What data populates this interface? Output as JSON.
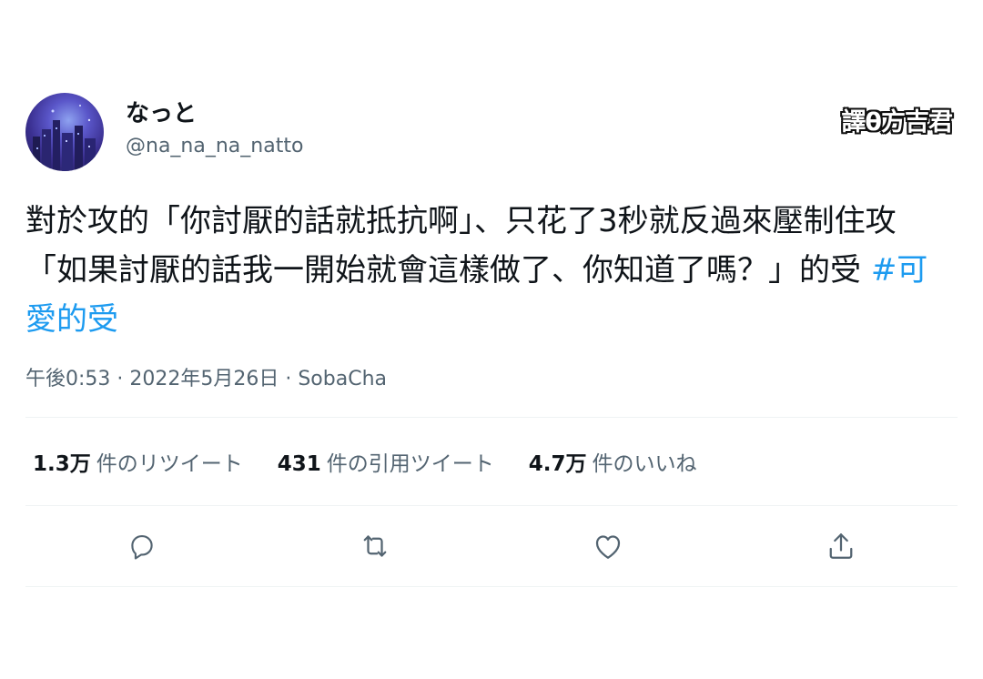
{
  "tweet": {
    "display_name": "なっと",
    "handle": "@na_na_na_natto",
    "watermark": "譯θ方吉君",
    "text": "對於攻的「你討厭的話就抵抗啊」、只花了3秒就反過來壓制住攻「如果討厭的話我一開始就會這樣做了、你知道了嗎？」的受",
    "hashtag": "#可愛的受",
    "timestamp": "午後0:53 · 2022年5月26日 · SobaCha"
  },
  "stats": {
    "retweets_num": "1.3万",
    "retweets_label": "件のリツイート",
    "quotes_num": "431",
    "quotes_label": "件の引用ツイート",
    "likes_num": "4.7万",
    "likes_label": "件のいいね"
  },
  "actions": {
    "reply_icon": "reply-icon",
    "retweet_icon": "retweet-icon",
    "like_icon": "heart-icon",
    "share_icon": "share-icon"
  },
  "colors": {
    "hashtag": "#1d9bf0",
    "secondary_text": "#536471",
    "primary_text": "#0f1419",
    "divider": "#eff3f4",
    "icon": "#536471"
  }
}
